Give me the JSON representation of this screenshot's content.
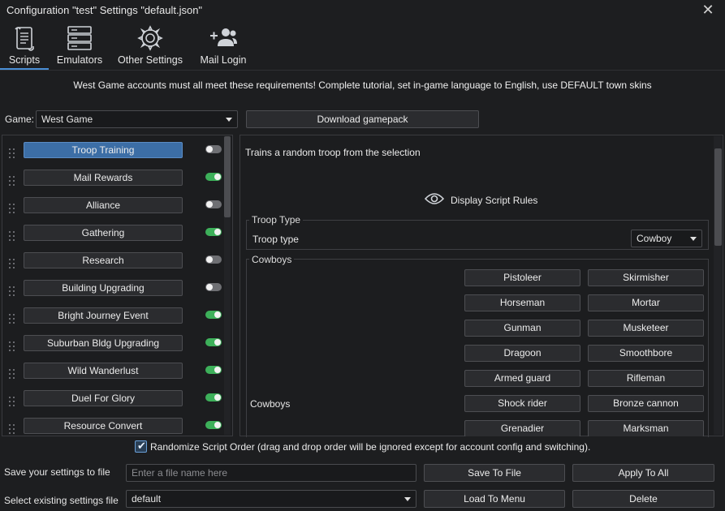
{
  "window": {
    "title": "Configuration \"test\" Settings \"default.json\"",
    "close_glyph": "✕"
  },
  "tabs": [
    {
      "label": "Scripts",
      "icon": "scroll-icon",
      "active": true
    },
    {
      "label": "Emulators",
      "icon": "server-icon"
    },
    {
      "label": "Other Settings",
      "icon": "gear-icon"
    },
    {
      "label": "Mail Login",
      "icon": "user-add-icon"
    }
  ],
  "notice": "West Game accounts must all meet these requirements! Complete tutorial, set in-game language to English, use DEFAULT town skins",
  "game": {
    "label": "Game:",
    "value": "West Game",
    "download_label": "Download gamepack"
  },
  "scripts": [
    {
      "label": "Troop Training",
      "enabled": false,
      "selected": true
    },
    {
      "label": "Mail Rewards",
      "enabled": true
    },
    {
      "label": "Alliance",
      "enabled": false
    },
    {
      "label": "Gathering",
      "enabled": true
    },
    {
      "label": "Research",
      "enabled": false
    },
    {
      "label": "Building Upgrading",
      "enabled": false
    },
    {
      "label": "Bright Journey Event",
      "enabled": true
    },
    {
      "label": "Suburban Bldg Upgrading",
      "enabled": true
    },
    {
      "label": "Wild Wanderlust",
      "enabled": true
    },
    {
      "label": "Duel For Glory",
      "enabled": true
    },
    {
      "label": "Resource Convert",
      "enabled": true
    }
  ],
  "detail": {
    "description": "Trains a random troop from the selection",
    "rules_label": "Display Script Rules",
    "troop_group_title": "Troop Type",
    "troop_label": "Troop type",
    "troop_value": "Cowboy",
    "cowboys_group_title": "Cowboys",
    "cowboys_label": "Cowboys",
    "units": [
      "Pistoleer",
      "Skirmisher",
      "Horseman",
      "Mortar",
      "Gunman",
      "Musketeer",
      "Dragoon",
      "Smoothbore",
      "Armed guard",
      "Rifleman",
      "Shock rider",
      "Bronze cannon",
      "Grenadier",
      "Marksman"
    ]
  },
  "bottom": {
    "randomize_label": "Randomize Script Order (drag and drop order will be ignored except for account config and switching).",
    "randomize_checked": true,
    "check_glyph": "✔",
    "save_label": "Save your settings to file",
    "filename_placeholder": "Enter a file name here",
    "save_button": "Save To File",
    "apply_button": "Apply To All",
    "select_label": "Select existing settings file",
    "select_value": "default",
    "load_button": "Load To Menu",
    "delete_button": "Delete"
  },
  "colors": {
    "accent": "#4a8fd6",
    "toggle_on": "#3db05a",
    "toggle_off": "#6e6f73",
    "selected_script": "#3c6ea6"
  }
}
